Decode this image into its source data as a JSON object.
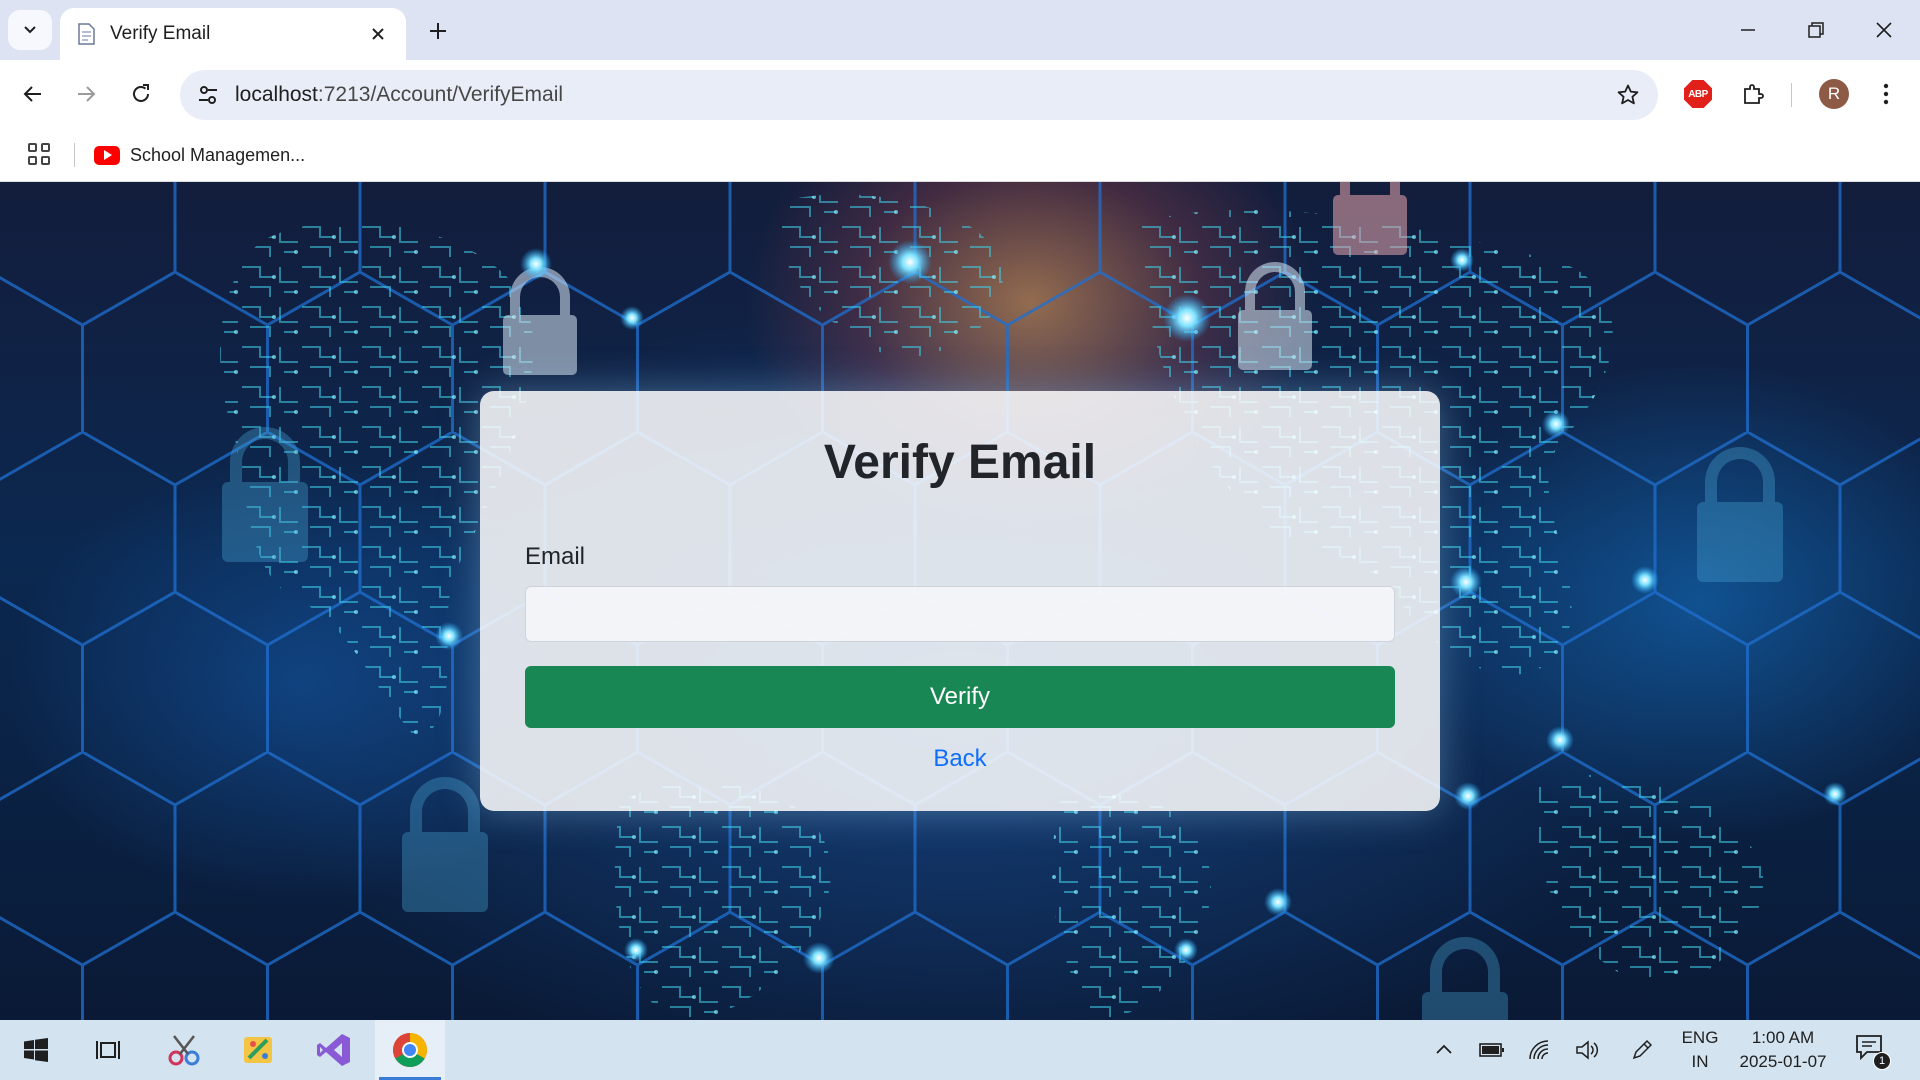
{
  "browser": {
    "tab": {
      "title": "Verify Email",
      "favicon": "page-icon"
    },
    "address": {
      "host": "localhost",
      "path": ":7213/Account/VerifyEmail"
    },
    "bookmarks": [
      {
        "label": "School Managemen...",
        "icon": "youtube-icon"
      }
    ],
    "profile_initial": "R",
    "extension_label": "ABP"
  },
  "page": {
    "title": "Verify Email",
    "email_label": "Email",
    "email_value": "",
    "verify_label": "Verify",
    "back_label": "Back"
  },
  "taskbar": {
    "language_line1": "ENG",
    "language_line2": "IN",
    "time": "1:00 AM",
    "date": "2025-01-07",
    "notification_count": "1"
  },
  "colors": {
    "primary_button": "#198754",
    "link": "#0d6efd",
    "tabstrip": "#dde3f3",
    "taskbar": "#d3e3ef"
  }
}
